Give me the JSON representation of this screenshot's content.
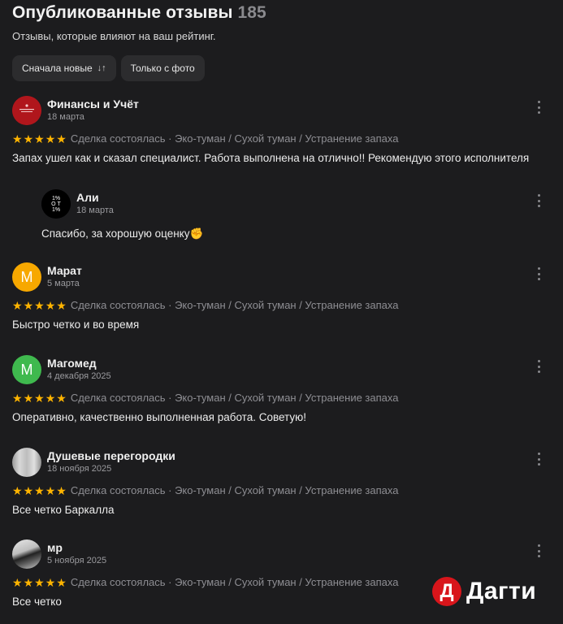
{
  "header": {
    "title": "Опубликованные отзывы",
    "count": "185",
    "subtitle": "Отзывы, которые влияют на ваш рейтинг."
  },
  "filters": {
    "sort_label": "Сначала новые",
    "sort_icon": "sort-arrows-icon",
    "photo_label": "Только с фото"
  },
  "reviews": [
    {
      "name": "Финансы и Учёт",
      "date": "18 марта",
      "rating": 5,
      "deal": "Сделка состоялась · Эко-туман / Сухой туман / Устранение запаха",
      "text": "Запах ушел как и сказал специалист. Работа выполнена на отлично!! Рекомендую этого исполнителя",
      "reply": {
        "name": "Али",
        "date": "18 марта",
        "text": "Спасибо, за хорошую оценку✊"
      }
    },
    {
      "name": "Марат",
      "avatar_letter": "М",
      "date": "5 марта",
      "rating": 5,
      "deal": "Сделка состоялась · Эко-туман / Сухой туман / Устранение запаха",
      "text": "Быстро четко и во время"
    },
    {
      "name": "Магомед",
      "avatar_letter": "М",
      "date": "4 декабря 2025",
      "rating": 5,
      "deal": "Сделка состоялась · Эко-туман / Сухой туман / Устранение запаха",
      "text": "Оперативно, качественно выполненная работа. Советую!"
    },
    {
      "name": "Душевые перегородки",
      "date": "18 ноября 2025",
      "rating": 5,
      "deal": "Сделка состоялась · Эко-туман / Сухой туман / Устранение запаха",
      "text": "Все четко Баркалла"
    },
    {
      "name": "мр",
      "date": "5 ноября 2025",
      "rating": 5,
      "deal": "Сделка состоялась · Эко-туман / Сухой туман / Устранение запаха",
      "text": "Все четко"
    }
  ],
  "watermark": {
    "badge": "Д",
    "text": "Дагти"
  },
  "colors": {
    "background": "#1c1c1e",
    "star": "#ffb400",
    "chip": "#2c2c2e",
    "brand_red": "#d8151b"
  }
}
